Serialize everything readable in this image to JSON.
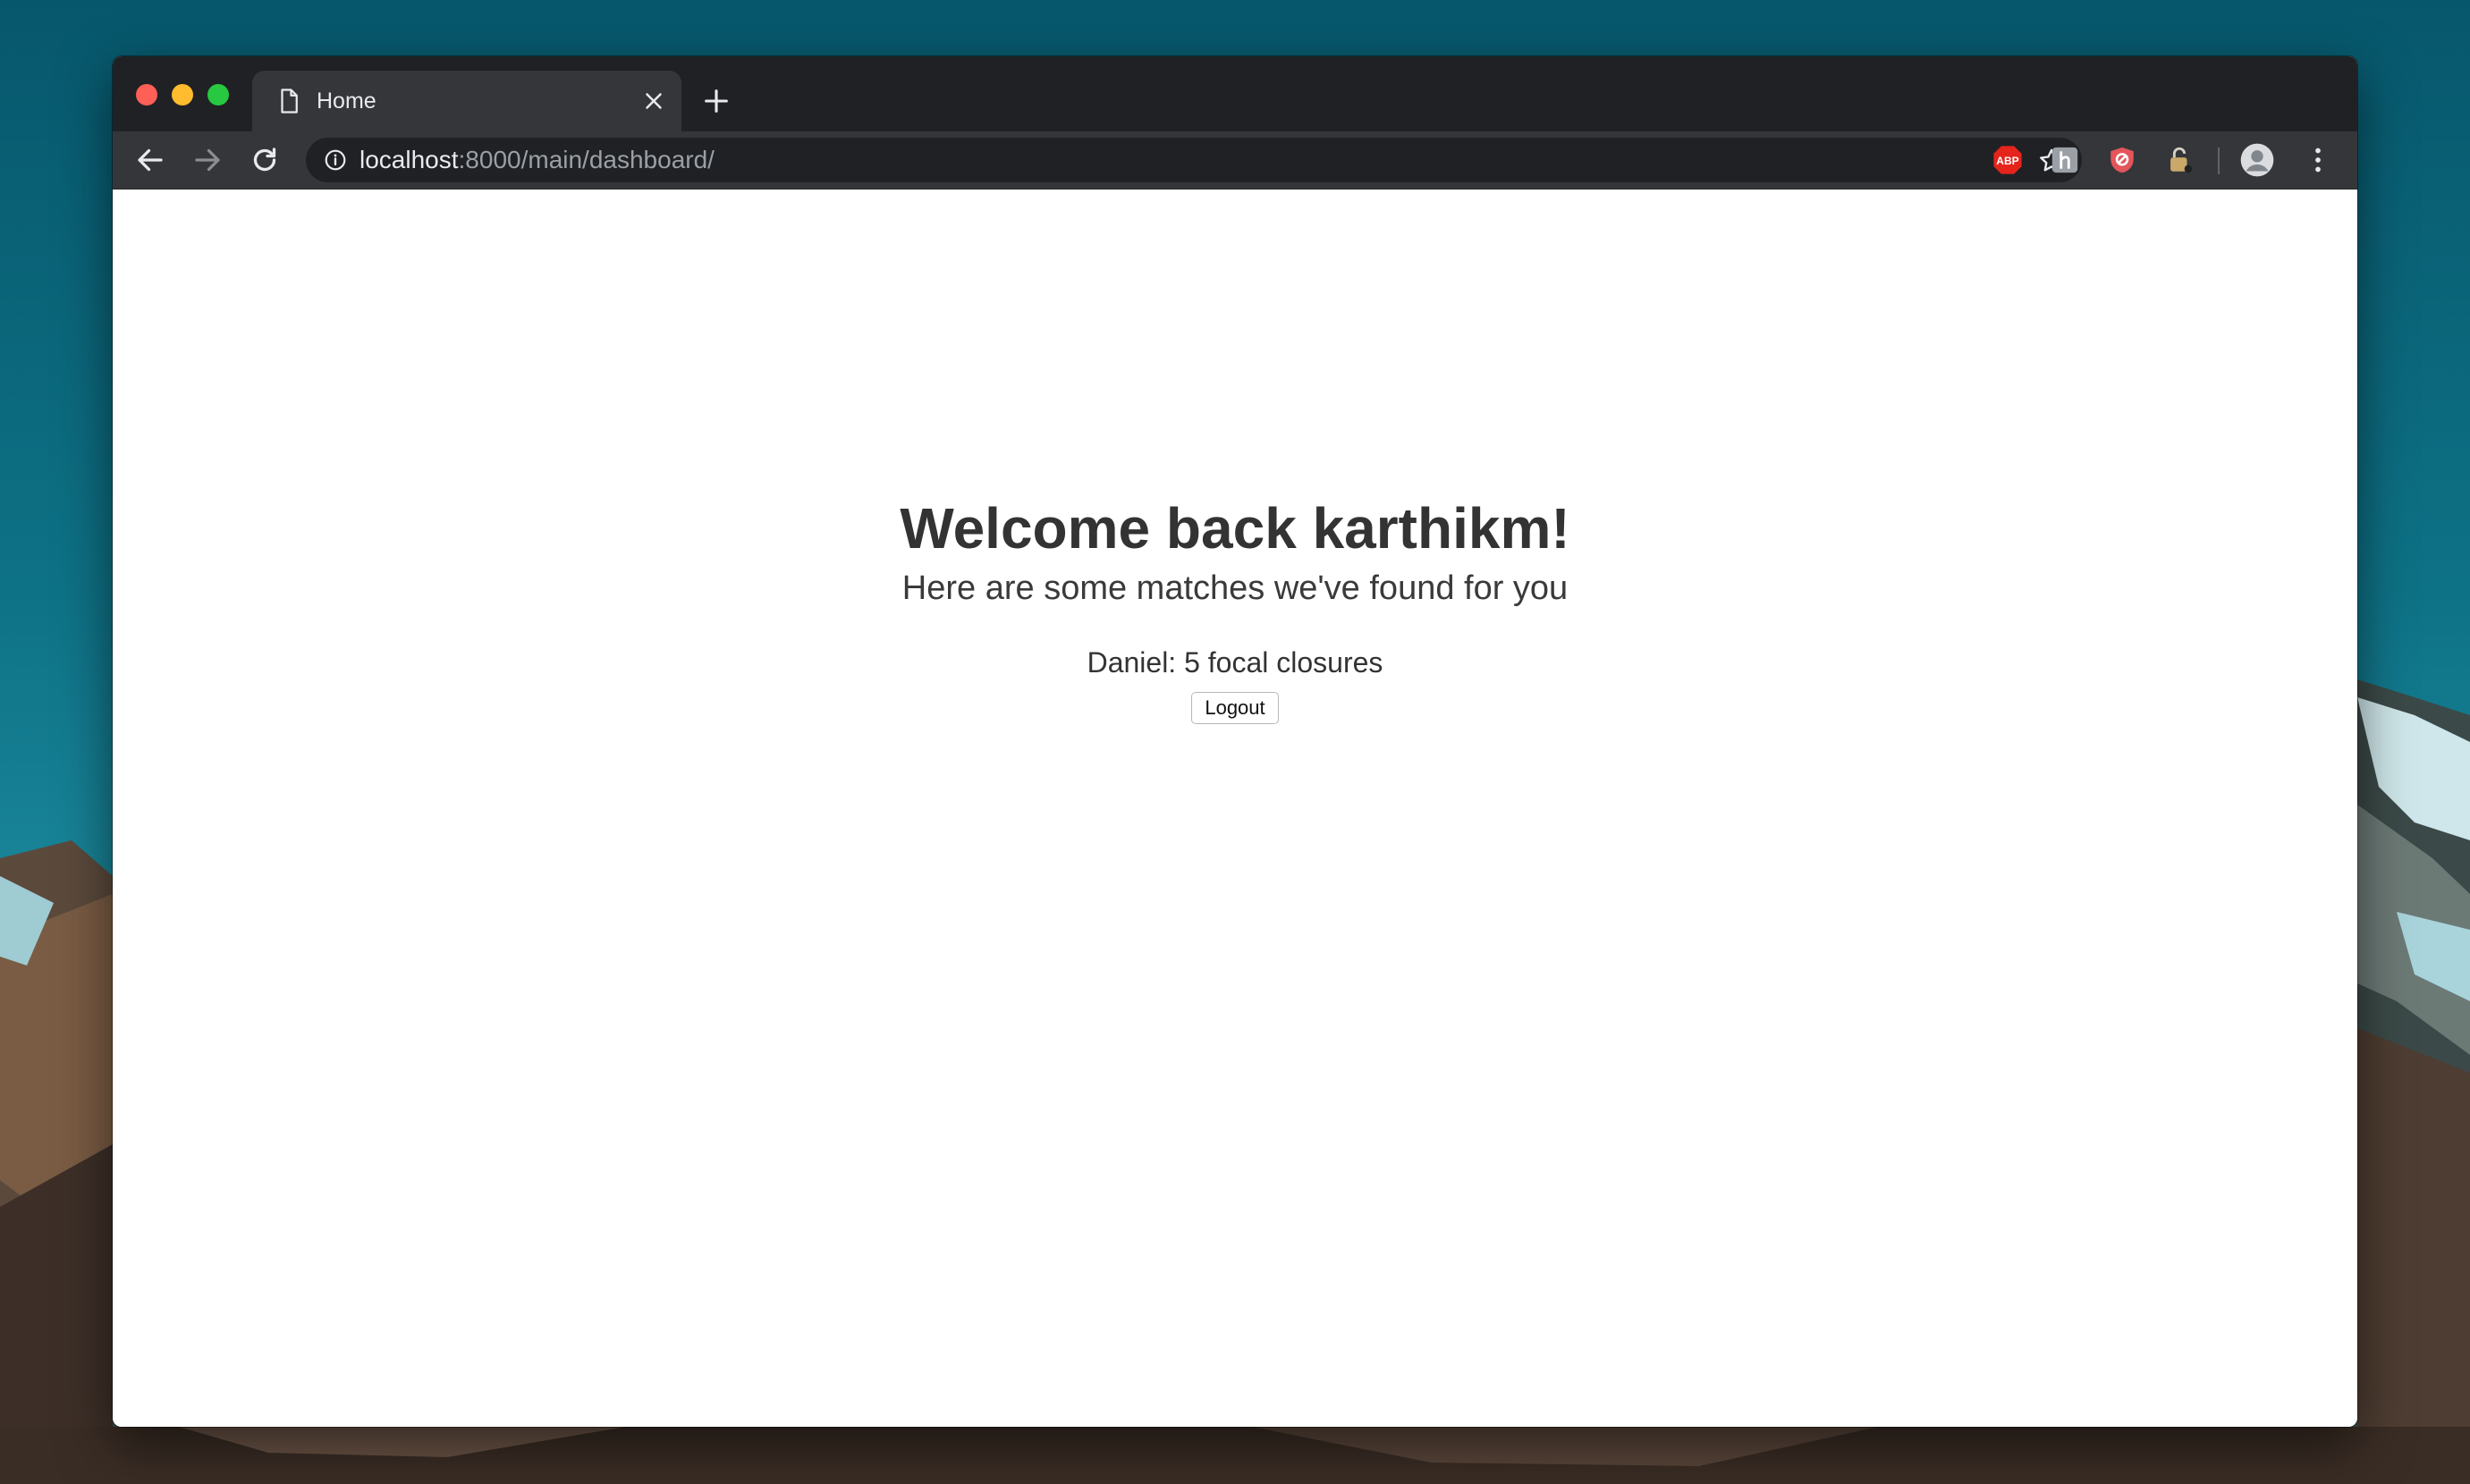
{
  "browser": {
    "tab": {
      "title": "Home",
      "icon": "document-icon"
    },
    "address": {
      "host": "localhost",
      "path": ":8000/main/dashboard/"
    },
    "extensions": [
      {
        "name": "adblock-plus-icon",
        "label": "ABP",
        "color": "#e5241b"
      },
      {
        "name": "extension-grey-icon",
        "color": "#9aa0a6"
      },
      {
        "name": "privacy-badger-shield-icon",
        "color": "#e4555b"
      },
      {
        "name": "lock-extension-icon",
        "color": "#c9a86a"
      }
    ],
    "colors": {
      "chrome_dark": "#202124",
      "chrome_toolbar": "#35363a",
      "traffic_red": "#fe5f57",
      "traffic_yellow": "#febc2e",
      "traffic_green": "#28c840"
    }
  },
  "page": {
    "heading": "Welcome back karthikm!",
    "subheading": "Here are some matches we've found for you",
    "matches": [
      {
        "text": "Daniel: 5 focal closures"
      }
    ],
    "logout_label": "Logout"
  }
}
